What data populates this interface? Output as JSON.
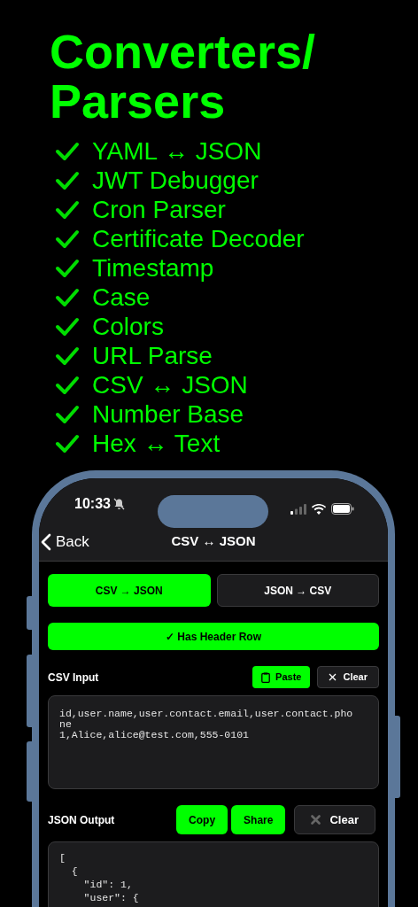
{
  "title_lines": [
    "Converters/",
    "Parsers"
  ],
  "features": [
    "YAML ↔ JSON",
    "JWT Debugger",
    "Cron Parser",
    "Certificate Decoder",
    "Timestamp",
    "Case",
    "Colors",
    "URL Parse",
    "CSV ↔ JSON",
    "Number Base",
    "Hex ↔ Text"
  ],
  "phone": {
    "status_bar": {
      "time": "10:33",
      "silent": true
    },
    "nav": {
      "back": "Back",
      "title": "CSV ↔ JSON"
    },
    "modes": [
      {
        "label": "CSV → JSON",
        "selected": true
      },
      {
        "label": "JSON → CSV",
        "selected": false
      }
    ],
    "header_toggle": {
      "label": "✓ Has Header Row",
      "checked": true
    },
    "input": {
      "label": "CSV Input",
      "buttons": [
        {
          "kind": "paste",
          "label": "Paste"
        },
        {
          "kind": "clear",
          "label": "Clear"
        }
      ],
      "value": "id,user.name,user.contact.email,user.contact.phone\n1,Alice,alice@test.com,555-0101"
    },
    "output": {
      "label": "JSON Output",
      "buttons": [
        {
          "kind": "copy",
          "label": "Copy"
        },
        {
          "kind": "share",
          "label": "Share"
        },
        {
          "kind": "clear",
          "label": "Clear"
        }
      ],
      "value": "[\n  {\n    \"id\": 1,\n    \"user\": {"
    }
  }
}
